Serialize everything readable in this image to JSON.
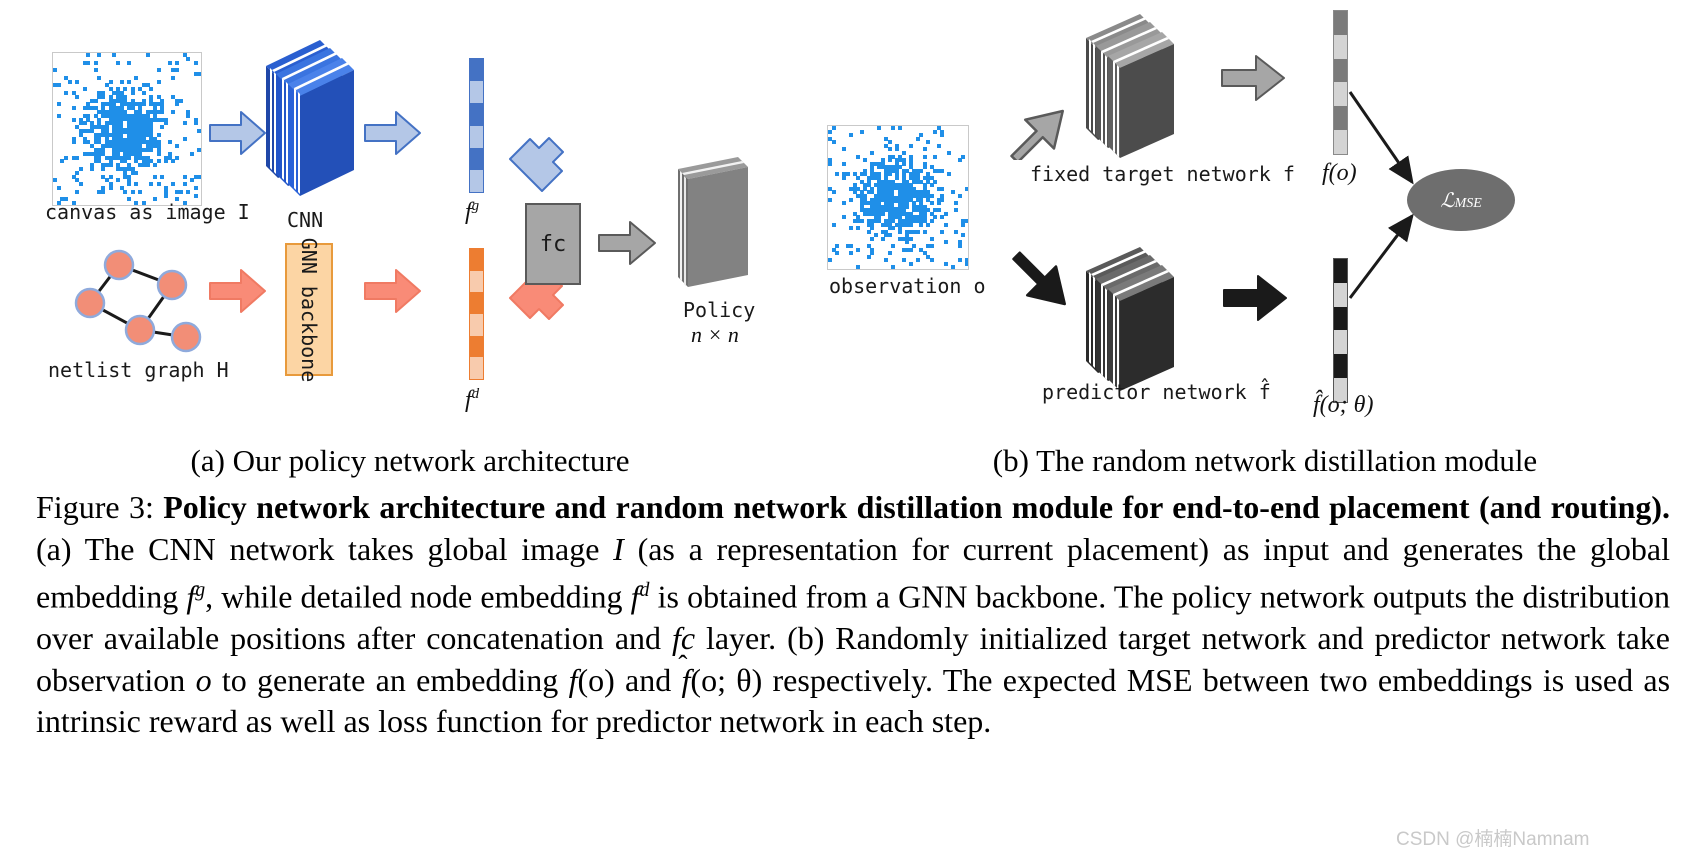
{
  "figure": {
    "label": "Figure 3:",
    "bold_title": "Policy network architecture and random network distillation module for end-to-end placement (and routing).",
    "caption_rest_1": " (a) The CNN network takes global image ",
    "caption_I": "I",
    "caption_rest_2": " (as a representation for current placement) as input and generates the global embedding ",
    "caption_fg": "f",
    "caption_fg_sup": "g",
    "caption_rest_3": ", while detailed node embedding ",
    "caption_fd": "f",
    "caption_fd_sup": "d",
    "caption_rest_4": " is obtained from a GNN backbone. The policy network outputs the distribution over available positions after concatenation and ",
    "caption_fc": "fc",
    "caption_rest_5": " layer. (b) Randomly initialized target network and predictor network take observation ",
    "caption_o": "o",
    "caption_rest_6": " to generate an embedding ",
    "caption_fo": "f",
    "caption_fo_args": "(o)",
    "caption_rest_7": " and ",
    "caption_fhat": "f",
    "caption_fhat_args": "(o; θ)",
    "caption_rest_8": " respectively. The expected MSE between two embeddings is used as intrinsic reward as well as loss function for predictor network in each step."
  },
  "subcaptions": {
    "a": "(a) Our policy network architecture",
    "b": "(b) The random network distillation module"
  },
  "panel_a": {
    "canvas_label": "canvas as image I",
    "cnn_label": "CNN",
    "fg_label_base": "f",
    "fg_label_sup": "g",
    "graph_label": "netlist graph H",
    "gnn_label": "GNN backbone",
    "fd_label_base": "f",
    "fd_label_sup": "d",
    "fc_label": "fc",
    "policy_label": "Policy",
    "policy_dims": "n × n"
  },
  "panel_b": {
    "observation_label": "observation o",
    "target_net_label": "fixed target network f",
    "predictor_net_label": "predictor network f̂",
    "fo_label": "f(o)",
    "fhat_label": "f̂(o; θ)",
    "loss_label": "ℒ",
    "loss_sub": "MSE"
  },
  "colors": {
    "blue_accent": "#1f8fe8",
    "blue_dark_vec": "#4472c4",
    "blue_light_vec": "#b4c7e7",
    "blue_arrow_fill": "#b4c7e7",
    "blue_arrow_stroke": "#4472c4",
    "orange_dark_vec": "#ed7d31",
    "orange_light_vec": "#f8cbad",
    "orange_arrow_fill": "#f98b77",
    "orange_arrow_stroke": "#f07a63",
    "gnn_fill": "#fcd5a4",
    "gnn_stroke": "#e89a3c",
    "gray_arrow_fill": "#a6a6a6",
    "gray_arrow_stroke": "#5a5a5a",
    "black_arrow_fill": "#1a1a1a",
    "policy_fill": "#808080",
    "ellipse_fill": "#6e6e6e",
    "node_fill": "#f28e77",
    "node_stroke": "#8faadc",
    "watermark": "#c9c9c9"
  },
  "watermark": "CSDN @楠楠Namnam",
  "chart_data": {
    "type": "diagram",
    "title": "Policy network architecture and random network distillation module",
    "panels": [
      {
        "id": "a",
        "title": "Our policy network architecture",
        "nodes": [
          "canvas as image I",
          "CNN",
          "f^g",
          "netlist graph H",
          "GNN backbone",
          "f^d",
          "fc",
          "Policy n x n"
        ],
        "edges": [
          "canvas as image I -> CNN",
          "CNN -> f^g",
          "f^g -> fc",
          "netlist graph H -> GNN backbone",
          "GNN backbone -> f^d",
          "f^d -> fc",
          "fc -> Policy n x n"
        ]
      },
      {
        "id": "b",
        "title": "The random network distillation module",
        "nodes": [
          "observation o",
          "fixed target network f",
          "predictor network f-hat",
          "f(o)",
          "f-hat(o; theta)",
          "L_MSE"
        ],
        "edges": [
          "observation o -> fixed target network f",
          "observation o -> predictor network f-hat",
          "fixed target network f -> f(o)",
          "predictor network f-hat -> f-hat(o; theta)",
          "f(o) -> L_MSE",
          "f-hat(o; theta) -> L_MSE"
        ]
      }
    ]
  },
  "vectors": {
    "fg": [
      "dark",
      "light",
      "dark",
      "light",
      "dark",
      "light"
    ],
    "fd": [
      "dark",
      "light",
      "dark",
      "light",
      "dark",
      "light"
    ],
    "fo": [
      "dark",
      "light",
      "dark",
      "light",
      "dark",
      "light"
    ],
    "fhat": [
      "black",
      "light",
      "black",
      "light",
      "black",
      "light"
    ]
  }
}
